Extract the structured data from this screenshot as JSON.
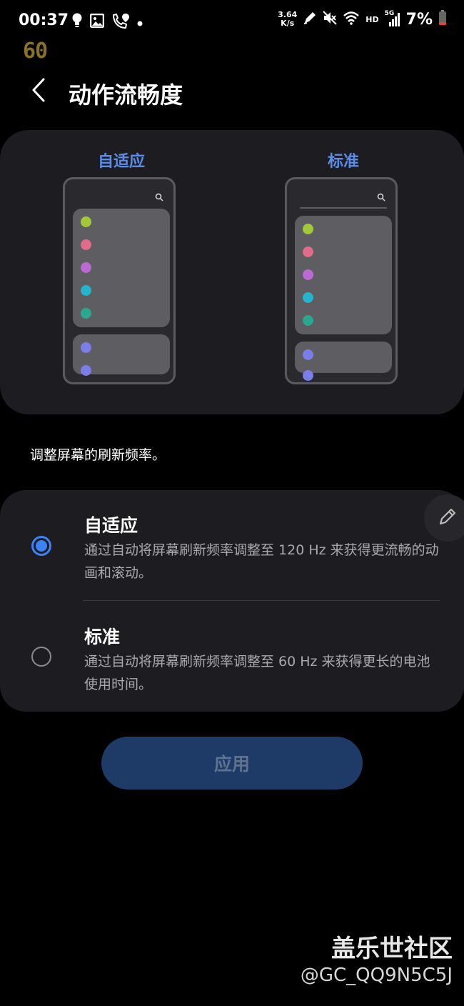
{
  "status_bar": {
    "time": "00:37",
    "net_speed_value": "3.64",
    "net_speed_unit": "K/s",
    "network_label": "HD",
    "signal_label": "5G",
    "battery": "7%",
    "left_icons": [
      "bulb-icon",
      "image-icon",
      "phone-location-icon",
      "dot-icon"
    ],
    "right_icons": [
      "pen-icon",
      "mute-icon",
      "wifi-icon",
      "signal-icon",
      "battery-icon"
    ]
  },
  "fps_overlay": "60",
  "header": {
    "title": "动作流畅度"
  },
  "preview": {
    "adaptive_label": "自适应",
    "standard_label": "标准",
    "dot_colors": [
      "#a3c93a",
      "#e06b8b",
      "#b96bd1",
      "#26b3cc",
      "#2aa88f"
    ],
    "bottom_dot_color": "#7a7ee8"
  },
  "description": "调整屏幕的刷新频率。",
  "options": [
    {
      "title": "自适应",
      "desc": "通过自动将屏幕刷新频率调整至 120 Hz 来获得更流畅的动画和滚动。",
      "selected": true
    },
    {
      "title": "标准",
      "desc": "通过自动将屏幕刷新频率调整至 60 Hz 来获得更长的电池使用时间。",
      "selected": false
    }
  ],
  "apply_label": "应用",
  "watermark": {
    "title": "盖乐世社区",
    "user": "@GC_QQ9N5C5J"
  },
  "colors": {
    "accent": "#3b82f6",
    "label_blue": "#5b8de8",
    "card": "#1c1c21"
  }
}
